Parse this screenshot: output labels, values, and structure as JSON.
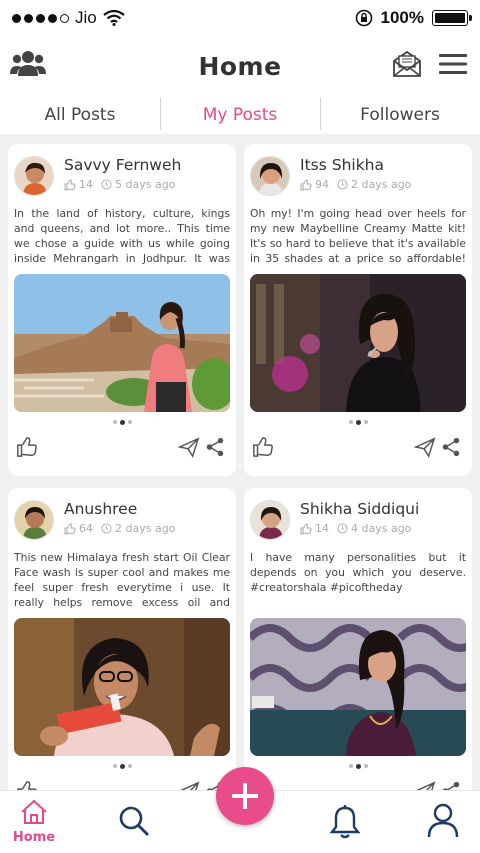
{
  "status_bar": {
    "carrier": "Jio",
    "battery": "100%"
  },
  "header": {
    "title": "Home"
  },
  "tabs": [
    {
      "label": "All Posts",
      "active": false
    },
    {
      "label": "My Posts",
      "active": true
    },
    {
      "label": "Followers",
      "active": false
    }
  ],
  "posts": [
    {
      "name": "Savvy Fernweh",
      "likes": "14",
      "time": "5 days ago",
      "text": "In the land of history, culture, kings and queens, and lot more.. This time we chose a guide with us while going inside Mehrangarh in Jodhpur. It was good. He"
    },
    {
      "name": "Itss Shikha",
      "likes": "94",
      "time": "2 days ago",
      "text": "Oh my! I'm going head over heels for my new Maybelline Creamy Matte kit! It's so hard to believe that it's available in 35 shades at a price so affordable! Just at"
    },
    {
      "name": "Anushree",
      "likes": "64",
      "time": "2 days ago",
      "text": "This new Himalaya fresh start Oil Clear Face wash is super cool and makes me feel super fresh everytime i use. It really helps remove excess oil and impurities"
    },
    {
      "name": "Shikha Siddiqui",
      "likes": "14",
      "time": "4 days ago",
      "text": "I have many personalities but it depends on you which you deserve. #creatorshala #picoftheday"
    }
  ],
  "bottom_nav": {
    "home_label": "Home"
  },
  "colors": {
    "accent": "#e24a8c",
    "fab": "#e84d8a"
  },
  "icons": [
    "group-icon",
    "mail-icon",
    "menu-icon",
    "thumbs-up-icon",
    "clock-icon",
    "send-icon",
    "share-icon",
    "home-icon",
    "search-icon",
    "plus-icon",
    "bell-icon",
    "user-icon"
  ]
}
